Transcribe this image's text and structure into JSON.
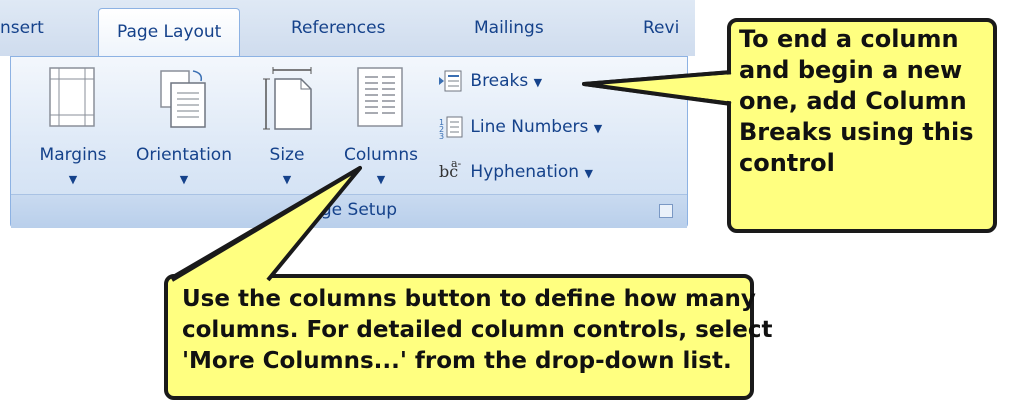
{
  "tabs": [
    {
      "label": "nsert",
      "active": false
    },
    {
      "label": "Page Layout",
      "active": true
    },
    {
      "label": "References",
      "active": false
    },
    {
      "label": "Mailings",
      "active": false
    },
    {
      "label": "Revi",
      "active": false
    }
  ],
  "ribbon": {
    "group_label": "Page Setup",
    "big_buttons": [
      {
        "label": "Margins",
        "icon": "margins-icon"
      },
      {
        "label": "Orientation",
        "icon": "orientation-icon"
      },
      {
        "label": "Size",
        "icon": "size-icon"
      },
      {
        "label": "Columns",
        "icon": "columns-icon"
      }
    ],
    "small_buttons": [
      {
        "label": "Breaks",
        "icon": "breaks-icon"
      },
      {
        "label": "Line Numbers",
        "icon": "line-numbers-icon"
      },
      {
        "label": "Hyphenation",
        "icon": "hyphenation-icon"
      }
    ],
    "dropdown_arrow": "▼",
    "hyphenation_glyph": "bc",
    "hyphenation_sup": "a-"
  },
  "callouts": {
    "breaks_lines": [
      "To end a column",
      "and begin a new",
      "one, add Column",
      "Breaks using this",
      "control"
    ],
    "columns_lines": [
      "Use the columns button to define how many",
      "columns. For detailed column controls, select",
      "'More Columns...' from the drop-down list."
    ]
  },
  "colors": {
    "callout_fill": "#ffff80",
    "ribbon_text": "#15428b",
    "ribbon_border": "#8db2e3"
  }
}
